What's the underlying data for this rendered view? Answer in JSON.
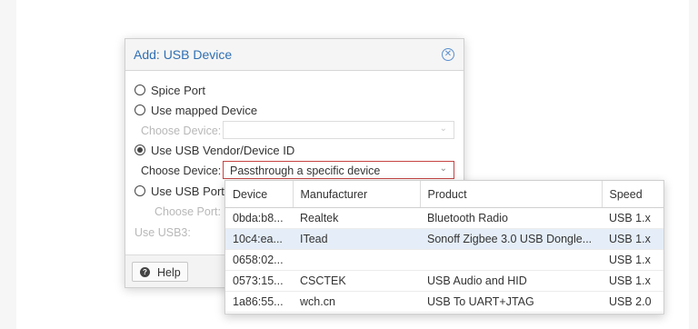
{
  "dialog": {
    "title": "Add: USB Device",
    "close_icon": "close-circle-icon",
    "options": {
      "spice_port": {
        "label": "Spice Port",
        "checked": false
      },
      "mapped_device": {
        "label": "Use mapped Device",
        "checked": false
      },
      "mapped_choose_label": "Choose Device:",
      "vendor_id": {
        "label": "Use USB Vendor/Device ID",
        "checked": true
      },
      "vendor_choose_label": "Choose Device:",
      "vendor_choose_value": "Passthrough a specific device",
      "usb_port": {
        "label": "Use USB Port",
        "checked": false
      },
      "port_choose_label": "Choose Port:",
      "usb3_label": "Use USB3:"
    },
    "footer": {
      "help_label": "Help",
      "help_icon": "question-circle-icon"
    }
  },
  "device_list": {
    "columns": [
      "Device",
      "Manufacturer",
      "Product",
      "Speed"
    ],
    "rows": [
      {
        "device": "0bda:b8...",
        "manufacturer": "Realtek",
        "product": "Bluetooth Radio",
        "speed": "USB 1.x",
        "selected": false
      },
      {
        "device": "10c4:ea...",
        "manufacturer": "ITead",
        "product": "Sonoff Zigbee 3.0 USB Dongle...",
        "speed": "USB 1.x",
        "selected": true
      },
      {
        "device": "0658:02...",
        "manufacturer": "",
        "product": "",
        "speed": "USB 1.x",
        "selected": false
      },
      {
        "device": "0573:15...",
        "manufacturer": "CSCTEK",
        "product": "USB Audio and HID",
        "speed": "USB 1.x",
        "selected": false
      },
      {
        "device": "1a86:55...",
        "manufacturer": "wch.cn",
        "product": "USB To UART+JTAG",
        "speed": "USB 2.0",
        "selected": false
      }
    ]
  }
}
